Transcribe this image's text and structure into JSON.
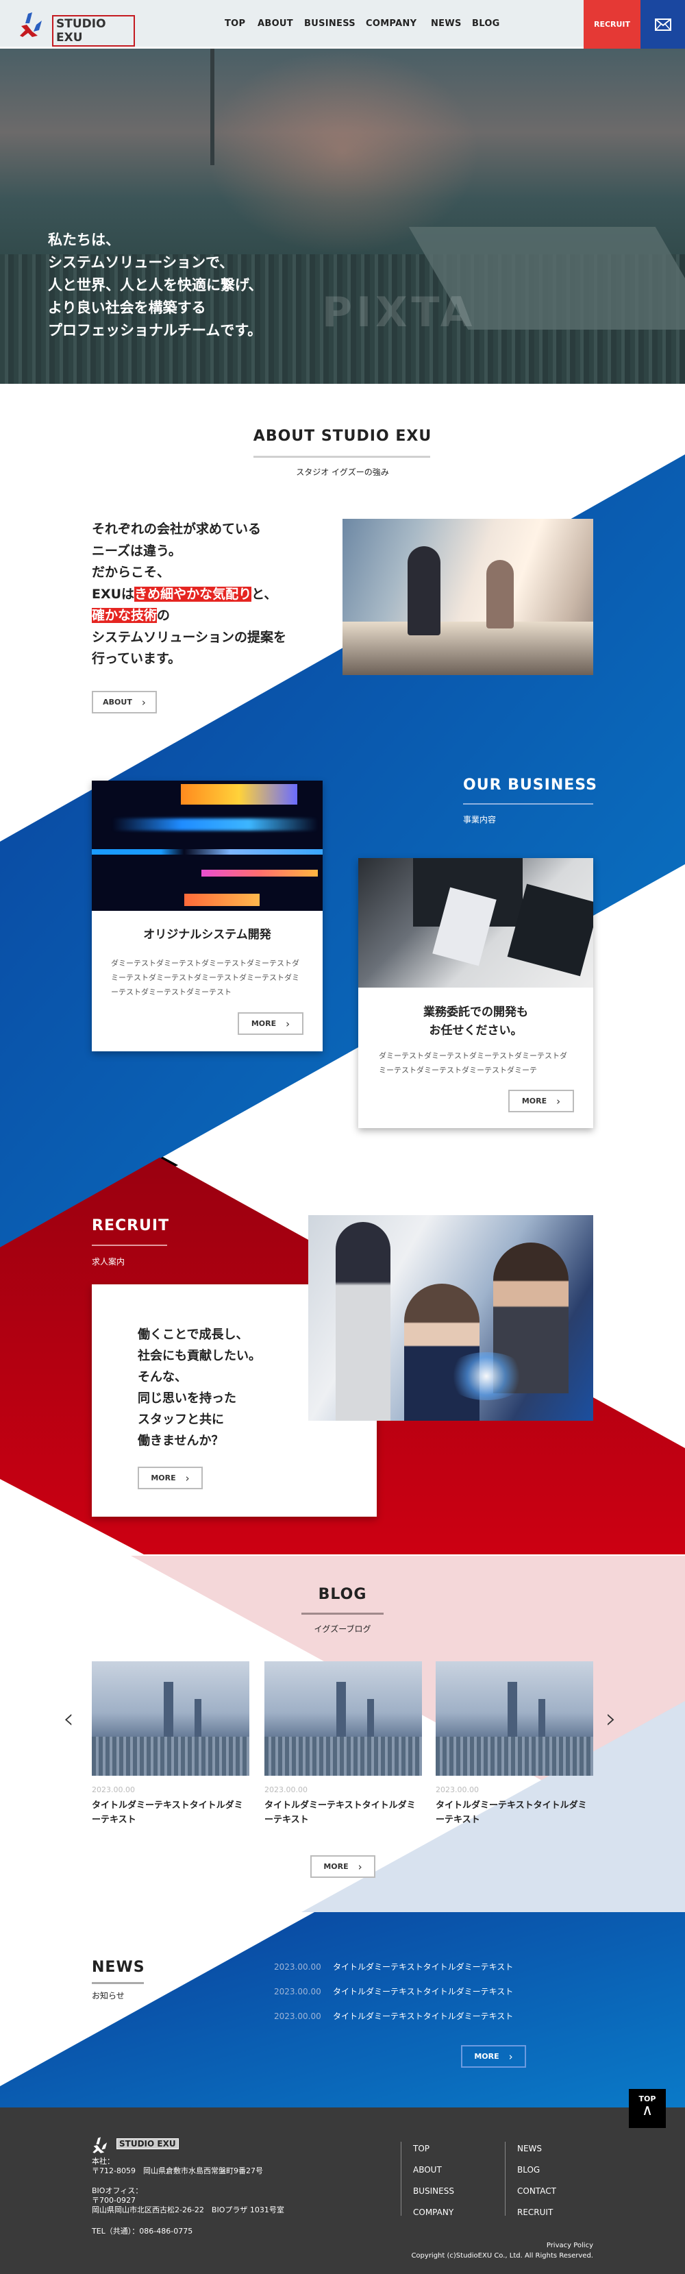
{
  "header": {
    "logo_text": "STUDIO EXU",
    "nav": [
      "TOP",
      "ABOUT",
      "BUSINESS",
      "COMPANY",
      "NEWS",
      "BLOG"
    ],
    "recruit_label": "RECRUIT",
    "mail_icon": "envelope-icon"
  },
  "hero": {
    "lines": [
      "私たちは、",
      "システムソリューションで、",
      "人と世界、人と人を快適に繋げ、",
      "より良い社会を構築する",
      "プロフェッショナルチームです。"
    ],
    "watermark": "PIXTA"
  },
  "about": {
    "title": "ABOUT STUDIO EXU",
    "subtitle": "スタジオ イグズーの強み",
    "line1": "それぞれの会社が求めている",
    "line2": "ニーズは違う。",
    "line3": "だからこそ、",
    "line4_pre": "EXUは",
    "line4_hl": "きめ細やかな気配り",
    "line4_post": "と、",
    "line5_hl": "確かな技術",
    "line5_post": "の",
    "line6": "システムソリューションの提案を",
    "line7": "行っています。",
    "button": "ABOUT"
  },
  "business": {
    "title": "OUR BUSINESS",
    "subtitle": "事業内容",
    "cards": [
      {
        "title": "オリジナルシステム開発",
        "body": "ダミーテストダミーテストダミーテストダミーテストダミーテストダミーテストダミーテストダミーテストダミーテストダミーテストダミーテスト",
        "button": "MORE"
      },
      {
        "title_1": "業務委託での開発も",
        "title_2": "お任せください。",
        "body": "ダミーテストダミーテストダミーテストダミーテストダミーテストダミーテストダミーテストダミーテ",
        "button": "MORE"
      }
    ]
  },
  "recruit": {
    "title": "RECRUIT",
    "subtitle": "求人案内",
    "lines": [
      "働くことで成長し、",
      "社会にも貢献したい。",
      "そんな、",
      "同じ思いを持った",
      "スタッフと共に",
      "働きませんか？"
    ],
    "button": "MORE"
  },
  "blog": {
    "title": "BLOG",
    "subtitle": "イグズーブログ",
    "posts": [
      {
        "date": "2023.00.00",
        "title": "タイトルダミーテキストタイトルダミーテキスト"
      },
      {
        "date": "2023.00.00",
        "title": "タイトルダミーテキストタイトルダミーテキスト"
      },
      {
        "date": "2023.00.00",
        "title": "タイトルダミーテキストタイトルダミーテキスト"
      }
    ],
    "button": "MORE"
  },
  "news": {
    "title": "NEWS",
    "subtitle": "お知らせ",
    "items": [
      {
        "date": "2023.00.00",
        "title": "タイトルダミーテキストタイトルダミーテキスト"
      },
      {
        "date": "2023.00.00",
        "title": "タイトルダミーテキストタイトルダミーテキスト"
      },
      {
        "date": "2023.00.00",
        "title": "タイトルダミーテキストタイトルダミーテキスト"
      }
    ],
    "button": "MORE"
  },
  "to_top": "TOP",
  "footer": {
    "logo_text": "STUDIO EXU",
    "hq_label": "本社：",
    "hq_address": "〒712-8059　岡山県倉敷市水島西常盤町9番27号",
    "bio_label": "BIOオフィス：",
    "bio_zip": "〒700-0927",
    "bio_address": "岡山県岡山市北区西古松2-26-22　BIOプラザ 1031号室",
    "tel": "TEL（共通）：086-486-0775",
    "nav_col1": [
      "TOP",
      "ABOUT",
      "BUSINESS",
      "COMPANY"
    ],
    "nav_col2": [
      "NEWS",
      "BLOG",
      "CONTACT",
      "RECRUIT"
    ],
    "privacy": "Privacy Policy",
    "copyright": "Copyright (c)StudioEXU Co., Ltd. All Rights Reserved."
  },
  "colors": {
    "brand_red": "#e53935",
    "brand_blue": "#1a47a0",
    "section_blue": "#0a56b0",
    "section_red": "#b0000f",
    "footer": "#3a3a3a"
  }
}
